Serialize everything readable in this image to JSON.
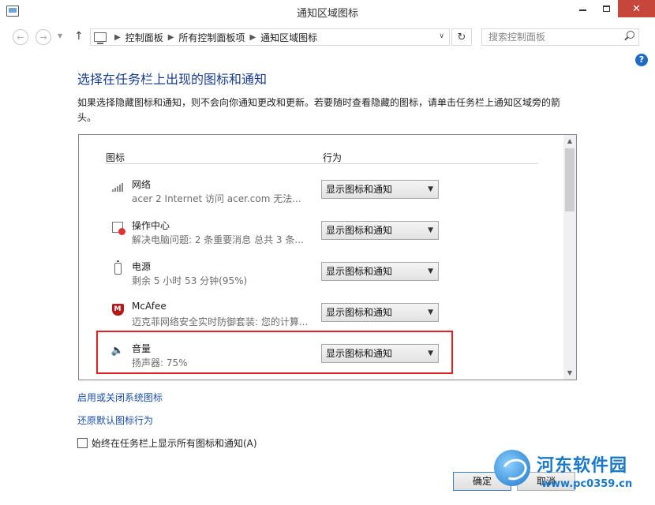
{
  "window": {
    "title": "通知区域图标",
    "close_glyph": "✕"
  },
  "nav": {
    "breadcrumb": [
      "控制面板",
      "所有控制面板项",
      "通知区域图标"
    ],
    "search_placeholder": "搜索控制面板"
  },
  "help": "?",
  "page": {
    "heading": "选择在任务栏上出现的图标和通知",
    "description": "如果选择隐藏图标和通知，则不会向你通知更改和更新。若要随时查看隐藏的图标，请单击任务栏上通知区域旁的箭头。"
  },
  "list": {
    "col_icon": "图标",
    "col_behavior": "行为",
    "items": [
      {
        "icon": "network-icon",
        "name": "网络",
        "detail": "acer  2 Internet 访问  acer.com 无法...",
        "behavior": "显示图标和通知"
      },
      {
        "icon": "action-center-icon",
        "name": "操作中心",
        "detail": "解决电脑问题: 2 条重要消息  总共 3 条...",
        "behavior": "显示图标和通知"
      },
      {
        "icon": "battery-icon",
        "name": "电源",
        "detail": "剩余 5 小时 53 分钟(95%)",
        "behavior": "显示图标和通知"
      },
      {
        "icon": "mcafee-icon",
        "name": "McAfee",
        "detail": "迈克菲网络安全实时防御套装: 您的计算...",
        "behavior": "显示图标和通知"
      },
      {
        "icon": "volume-icon",
        "name": "音量",
        "detail": "扬声器: 75%",
        "behavior": "显示图标和通知"
      }
    ]
  },
  "links": {
    "system_icons": "启用或关闭系统图标",
    "restore_defaults": "还原默认图标行为"
  },
  "always_show_label": "始终在任务栏上显示所有图标和通知(A)",
  "buttons": {
    "ok": "确定",
    "cancel": "取消"
  },
  "watermark": {
    "name": "河东软件园",
    "url": "www.pc0359.cn"
  },
  "colors": {
    "heading": "#1a3d8f",
    "link": "#1a4fa5",
    "close_button": "#c7463b",
    "highlight_box": "#e02020"
  }
}
